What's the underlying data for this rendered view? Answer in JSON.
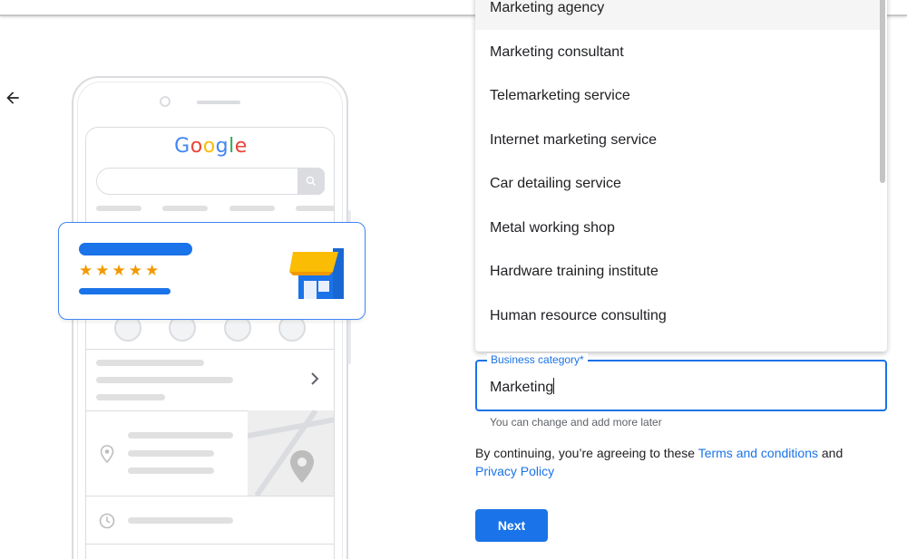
{
  "dropdown": {
    "items": [
      {
        "label": "Marketing agency"
      },
      {
        "label": "Marketing consultant"
      },
      {
        "label": "Telemarketing service"
      },
      {
        "label": "Internet marketing service"
      },
      {
        "label": "Car detailing service"
      },
      {
        "label": "Metal working shop"
      },
      {
        "label": "Hardware training institute"
      },
      {
        "label": "Human resource consulting"
      }
    ]
  },
  "field": {
    "label": "Business category*",
    "value": "Marketing",
    "helper": "You can change and add more later"
  },
  "terms": {
    "prefix": "By continuing, you’re agreeing to these ",
    "terms_link": "Terms and conditions",
    "middle": " and",
    "privacy_link": "Privacy Policy"
  },
  "next_label": "Next",
  "illustration": {
    "logo_letters": [
      "G",
      "o",
      "o",
      "g",
      "l",
      "e"
    ],
    "card_rating_stars": 5
  },
  "colors": {
    "accent": "#1a73e8",
    "star": "#f29900",
    "store_awning": "#fbbc04"
  },
  "icons": {
    "back": "arrow-back-icon",
    "search": "search-icon",
    "store": "store-icon",
    "chevron": "chevron-right-icon",
    "pin": "location-pin-icon",
    "clock": "clock-icon"
  }
}
